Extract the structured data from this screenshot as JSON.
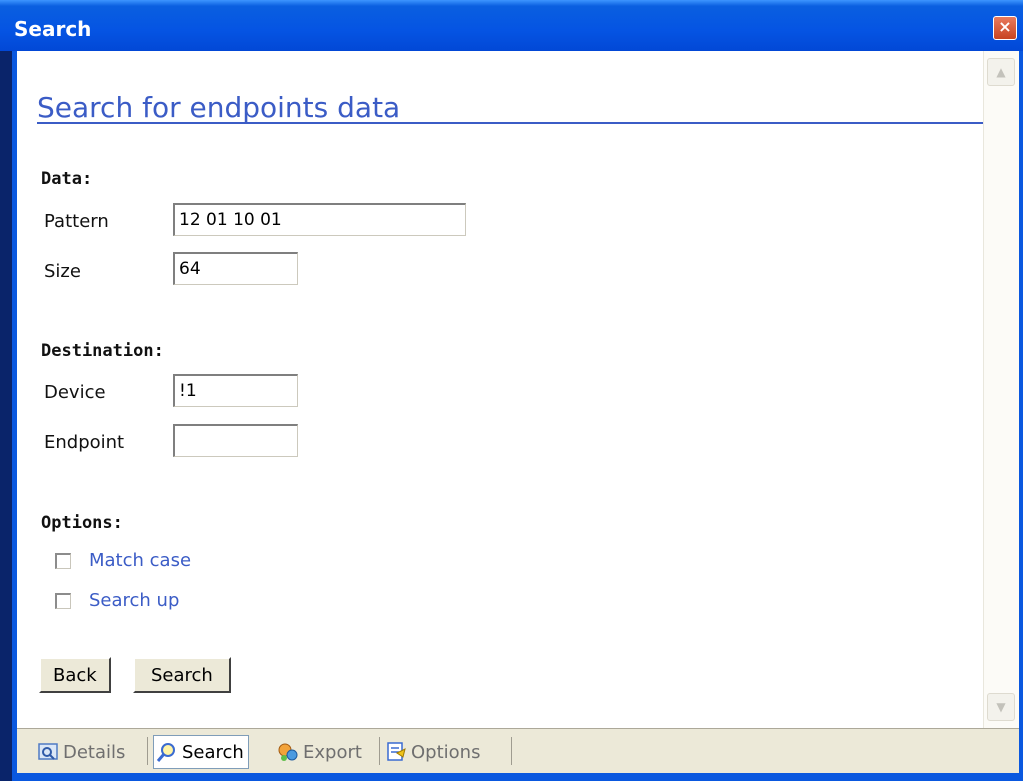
{
  "window": {
    "title": "Search",
    "close_glyph": "×"
  },
  "page": {
    "heading": "Search for endpoints data"
  },
  "data_section": {
    "label": "Data:",
    "pattern_label": "Pattern",
    "pattern_value": "12 01 10 01",
    "size_label": "Size",
    "size_value": "64"
  },
  "destination_section": {
    "label": "Destination:",
    "device_label": "Device",
    "device_value": "!1",
    "endpoint_label": "Endpoint",
    "endpoint_value": ""
  },
  "options_section": {
    "label": "Options:",
    "match_case_label": "Match case",
    "match_case_checked": false,
    "search_up_label": "Search up",
    "search_up_checked": false
  },
  "buttons": {
    "back_label": "Back",
    "search_label": "Search"
  },
  "tabs": [
    {
      "label": "Details",
      "icon": "details-icon",
      "active": false
    },
    {
      "label": "Search",
      "icon": "magnifier-icon",
      "active": true
    },
    {
      "label": "Export",
      "icon": "export-icon",
      "active": false
    },
    {
      "label": "Options",
      "icon": "options-icon",
      "active": false
    }
  ],
  "colors": {
    "titlebar": "#0554e3",
    "accent": "#3b5cc6",
    "panel": "#ece9d8"
  }
}
